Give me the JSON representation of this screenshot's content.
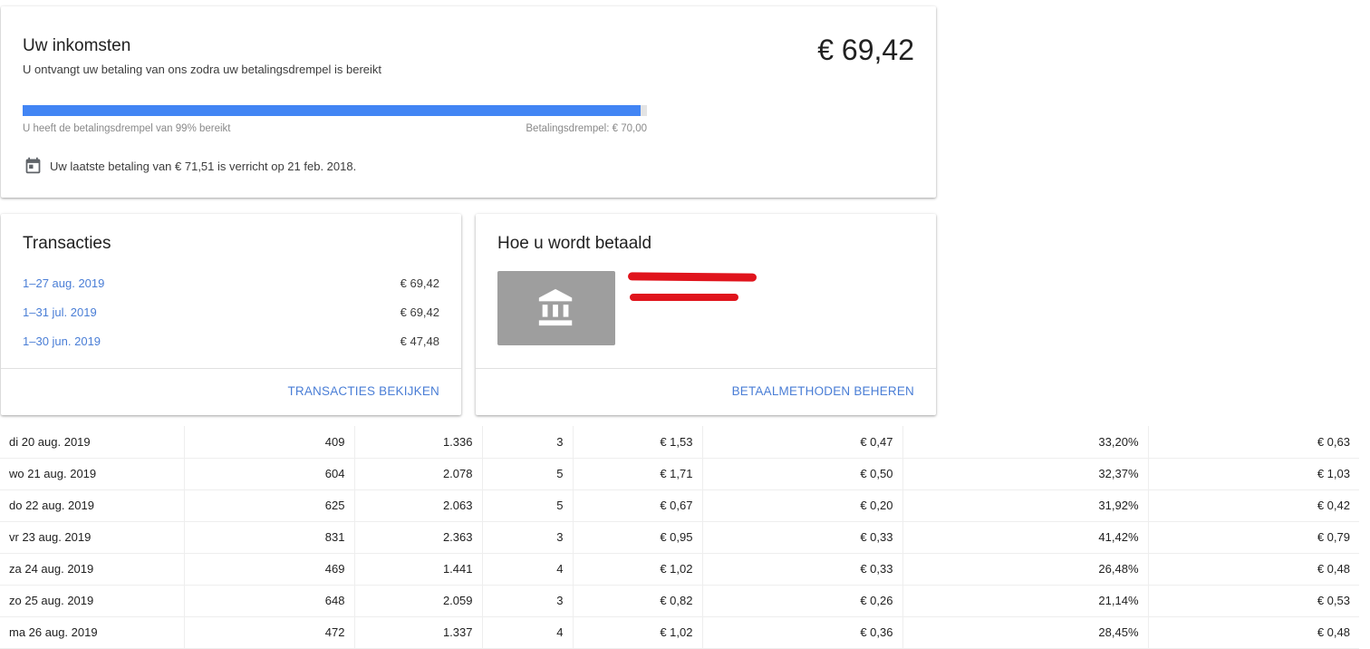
{
  "earnings": {
    "title": "Uw inkomsten",
    "subtitle": "U ontvangt uw betaling van ons zodra uw betalingsdrempel is bereikt",
    "amount": "€ 69,42",
    "progress_percent": 99,
    "progress_label": "U heeft de betalingsdrempel van 99% bereikt",
    "threshold_label": "Betalingsdrempel: € 70,00",
    "last_payment": "Uw laatste betaling van € 71,51 is verricht op 21 feb. 2018.",
    "icon": "calendar-icon",
    "accent_color": "#4285f4"
  },
  "transactions": {
    "title": "Transacties",
    "items": [
      {
        "period": "1–27 aug. 2019",
        "value": "€ 69,42"
      },
      {
        "period": "1–31 jul. 2019",
        "value": "€ 69,42"
      },
      {
        "period": "1–30 jun. 2019",
        "value": "€ 47,48"
      }
    ],
    "action_label": "TRANSACTIES BEKIJKEN"
  },
  "payment": {
    "title": "Hoe u wordt betaald",
    "icon": "bank-icon",
    "action_label": "BETAALMETHODEN BEHEREN"
  },
  "table": {
    "rows": [
      [
        "di 20 aug. 2019",
        "409",
        "1.336",
        "3",
        "€ 1,53",
        "€ 0,47",
        "33,20%",
        "€ 0,63"
      ],
      [
        "wo 21 aug. 2019",
        "604",
        "2.078",
        "5",
        "€ 1,71",
        "€ 0,50",
        "32,37%",
        "€ 1,03"
      ],
      [
        "do 22 aug. 2019",
        "625",
        "2.063",
        "5",
        "€ 0,67",
        "€ 0,20",
        "31,92%",
        "€ 0,42"
      ],
      [
        "vr 23 aug. 2019",
        "831",
        "2.363",
        "3",
        "€ 0,95",
        "€ 0,33",
        "41,42%",
        "€ 0,79"
      ],
      [
        "za 24 aug. 2019",
        "469",
        "1.441",
        "4",
        "€ 1,02",
        "€ 0,33",
        "26,48%",
        "€ 0,48"
      ],
      [
        "zo 25 aug. 2019",
        "648",
        "2.059",
        "3",
        "€ 0,82",
        "€ 0,26",
        "21,14%",
        "€ 0,53"
      ],
      [
        "ma 26 aug. 2019",
        "472",
        "1.337",
        "4",
        "€ 1,02",
        "€ 0,36",
        "28,45%",
        "€ 0,48"
      ]
    ]
  }
}
